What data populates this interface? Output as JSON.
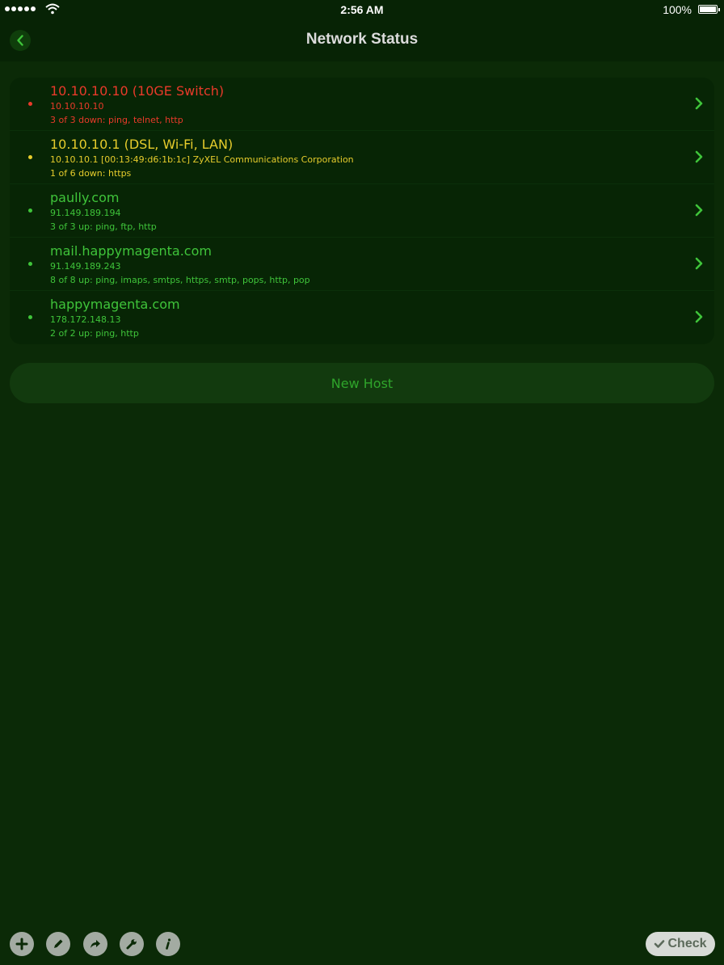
{
  "status_bar": {
    "time": "2:56 AM",
    "battery": "100%"
  },
  "nav": {
    "title": "Network Status",
    "back_icon": "chevron-left-icon"
  },
  "hosts": [
    {
      "name": "10.10.10.10 (10GE Switch)",
      "address": "10.10.10.10",
      "status": "3 of 3 down: ping, telnet, http",
      "state": "down",
      "color": "#e93a2a"
    },
    {
      "name": "10.10.10.1 (DSL, Wi-Fi, LAN)",
      "address": "10.10.10.1 [00:13:49:d6:1b:1c] ZyXEL Communications Corporation",
      "status": "1 of 6 down: https",
      "state": "warning",
      "color": "#e6cc2c"
    },
    {
      "name": "paully.com",
      "address": "91.149.189.194",
      "status": "3 of 3 up: ping, ftp, http",
      "state": "up",
      "color": "#3fc43a"
    },
    {
      "name": "mail.happymagenta.com",
      "address": "91.149.189.243",
      "status": "8 of 8 up: ping, imaps, smtps, https, smtp, pops, http, pop",
      "state": "up",
      "color": "#3fc43a"
    },
    {
      "name": "happymagenta.com",
      "address": "178.172.148.13",
      "status": "2 of 2 up: ping, http",
      "state": "up",
      "color": "#3fc43a"
    }
  ],
  "new_host_label": "New Host",
  "toolbar": {
    "icons": [
      "plus-icon",
      "pencil-icon",
      "share-icon",
      "wrench-icon",
      "info-icon"
    ],
    "check_label": "Check",
    "check_icon": "checkmark-icon"
  },
  "colors": {
    "background": "#0b2a07",
    "down": "#e93a2a",
    "warning": "#e6cc2c",
    "up": "#3fc43a"
  }
}
